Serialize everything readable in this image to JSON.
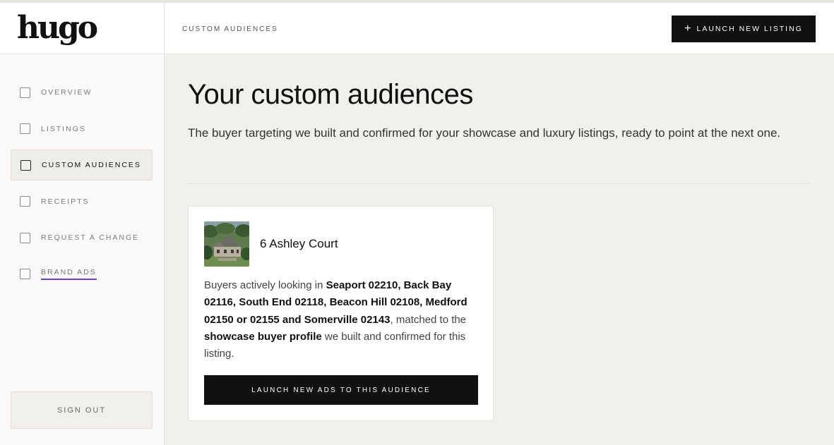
{
  "brand": {
    "logo_text": "hugo"
  },
  "sidebar": {
    "items": [
      {
        "label": "OVERVIEW"
      },
      {
        "label": "LISTINGS"
      },
      {
        "label": "CUSTOM AUDIENCES"
      },
      {
        "label": "RECEIPTS"
      },
      {
        "label": "REQUEST A CHANGE"
      },
      {
        "label": "BRAND ADS"
      }
    ],
    "active_item": "CUSTOM AUDIENCES",
    "signout_label": "SIGN OUT"
  },
  "header": {
    "breadcrumb": "CUSTOM AUDIENCES",
    "launch_button_label": "LAUNCH NEW LISTING",
    "launch_button_icon": "plus-icon"
  },
  "main": {
    "title": "Your custom audiences",
    "subtitle": "The buyer targeting we built and confirmed for your showcase and luxury listings, ready to point at the next one."
  },
  "audience_card": {
    "address": "6 Ashley Court",
    "body_prefix": "Buyers actively looking in ",
    "locations": "Seaport 02210, Back Bay 02116, South End 02118, Beacon Hill 02108, Medford 02150 or 02155 and Somerville 02143",
    "body_middle": ", matched to the ",
    "profile": "showcase buyer profile",
    "body_suffix": " we built and confirmed for this listing.",
    "button_label": "LAUNCH NEW ADS TO THIS AUDIENCE"
  },
  "colors": {
    "accent_underline": "#6a3fd1",
    "button_bg": "#111111",
    "page_bg": "#f2f0ec"
  }
}
